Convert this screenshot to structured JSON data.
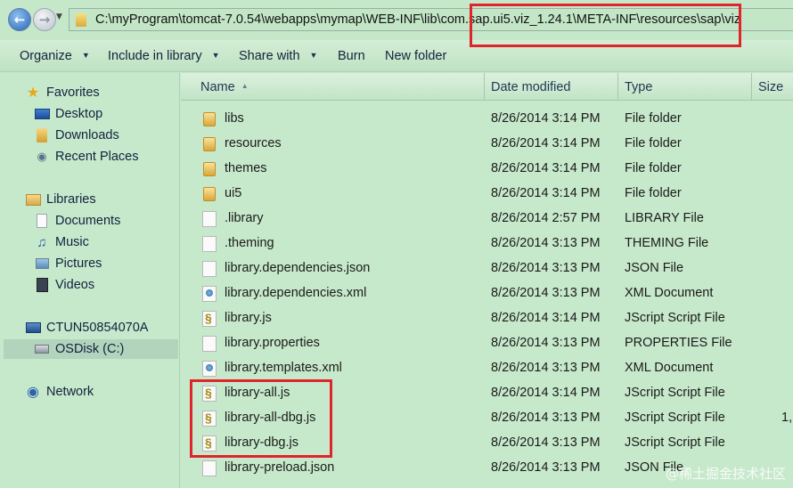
{
  "address": {
    "path": "C:\\myProgram\\tomcat-7.0.54\\webapps\\mymap\\WEB-INF\\lib\\com.sap.ui5.viz_1.24.1\\META-INF\\resources\\sap\\viz"
  },
  "toolbar": {
    "organize": "Organize",
    "include_in_library": "Include in library",
    "share_with": "Share with",
    "burn": "Burn",
    "new_folder": "New folder"
  },
  "sidebar": {
    "favorites": "Favorites",
    "desktop": "Desktop",
    "downloads": "Downloads",
    "recent_places": "Recent Places",
    "libraries": "Libraries",
    "documents": "Documents",
    "music": "Music",
    "pictures": "Pictures",
    "videos": "Videos",
    "computer": "CTUN50854070A",
    "osdisk": "OSDisk (C:)",
    "network": "Network"
  },
  "columns": {
    "name": "Name",
    "date_modified": "Date modified",
    "type": "Type",
    "size": "Size"
  },
  "files": [
    {
      "name": "libs",
      "date": "8/26/2014 3:14 PM",
      "type": "File folder",
      "size": "",
      "icon": "folder-icon"
    },
    {
      "name": "resources",
      "date": "8/26/2014 3:14 PM",
      "type": "File folder",
      "size": "",
      "icon": "folder-icon"
    },
    {
      "name": "themes",
      "date": "8/26/2014 3:14 PM",
      "type": "File folder",
      "size": "",
      "icon": "folder-icon"
    },
    {
      "name": "ui5",
      "date": "8/26/2014 3:14 PM",
      "type": "File folder",
      "size": "",
      "icon": "folder-icon"
    },
    {
      "name": ".library",
      "date": "8/26/2014 2:57 PM",
      "type": "LIBRARY File",
      "size": "",
      "icon": "file-icon"
    },
    {
      "name": ".theming",
      "date": "8/26/2014 3:13 PM",
      "type": "THEMING File",
      "size": "",
      "icon": "file-icon"
    },
    {
      "name": "library.dependencies.json",
      "date": "8/26/2014 3:13 PM",
      "type": "JSON File",
      "size": "",
      "icon": "file-icon"
    },
    {
      "name": "library.dependencies.xml",
      "date": "8/26/2014 3:13 PM",
      "type": "XML Document",
      "size": "",
      "icon": "xml-file-icon"
    },
    {
      "name": "library.js",
      "date": "8/26/2014 3:14 PM",
      "type": "JScript Script File",
      "size": "",
      "icon": "script-file-icon"
    },
    {
      "name": "library.properties",
      "date": "8/26/2014 3:13 PM",
      "type": "PROPERTIES File",
      "size": "",
      "icon": "file-icon"
    },
    {
      "name": "library.templates.xml",
      "date": "8/26/2014 3:13 PM",
      "type": "XML Document",
      "size": "",
      "icon": "xml-file-icon"
    },
    {
      "name": "library-all.js",
      "date": "8/26/2014 3:14 PM",
      "type": "JScript Script File",
      "size": "",
      "icon": "script-file-icon"
    },
    {
      "name": "library-all-dbg.js",
      "date": "8/26/2014 3:13 PM",
      "type": "JScript Script File",
      "size": "1,",
      "icon": "script-file-icon"
    },
    {
      "name": "library-dbg.js",
      "date": "8/26/2014 3:13 PM",
      "type": "JScript Script File",
      "size": "",
      "icon": "script-file-icon"
    },
    {
      "name": "library-preload.json",
      "date": "8/26/2014 3:13 PM",
      "type": "JSON File",
      "size": "",
      "icon": "file-icon"
    }
  ],
  "watermark": "@稀土掘金技术社区",
  "colors": {
    "background": "#c7e9cb",
    "highlight": "#e0252a",
    "selected": "#b3d4bc"
  }
}
